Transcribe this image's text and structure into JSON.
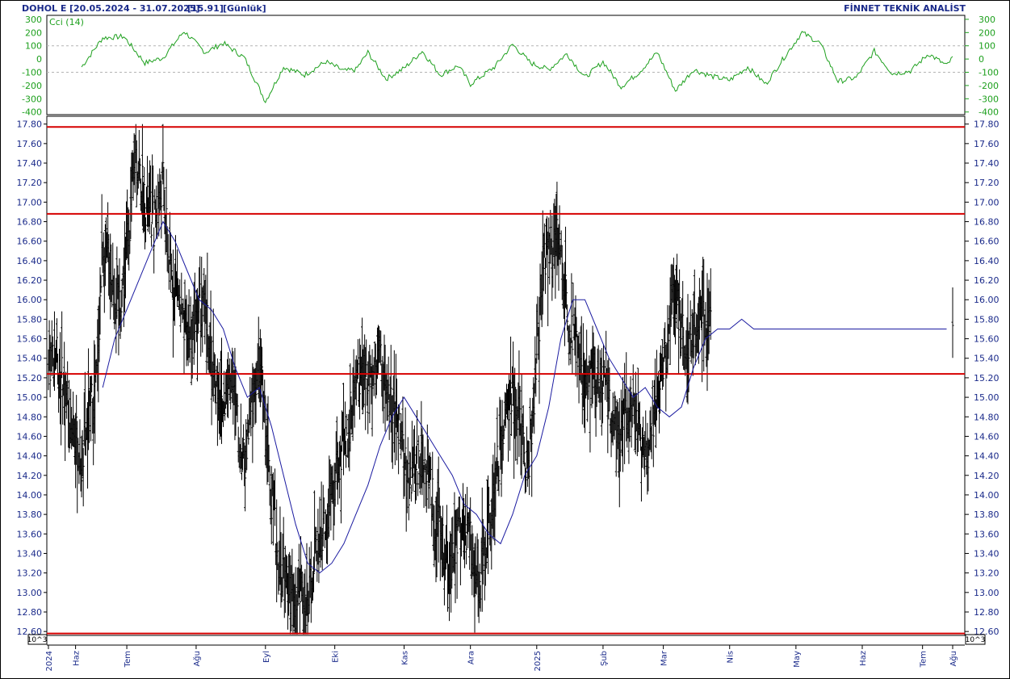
{
  "header": {
    "symbol": "DOHOL E",
    "date_range": "[20.05.2024 - 31.07.2025]",
    "last_price": "[15.91]",
    "period": "[Günlük]",
    "brand": "FİNNET TEKNİK ANALİST"
  },
  "colors": {
    "text": "#1a2a8a",
    "cci": "#1ea01e",
    "ma": "#1a1aa0",
    "bars": "#000000",
    "levels": "#d60000",
    "grid": "#b4b4b4",
    "frame": "#000000"
  },
  "chart_data": [
    {
      "type": "line",
      "label": "Cci (14)",
      "ylim": [
        -420,
        330
      ],
      "y_ticks": [
        300,
        200,
        100,
        0,
        -100,
        -200,
        -300,
        -400
      ],
      "y_tick_labels": [
        "300",
        "200",
        "100",
        "0",
        "-100",
        "-200",
        "-300",
        "-400"
      ],
      "dashed_levels": [
        100,
        -100
      ],
      "x_range": [
        0,
        300
      ],
      "x": [
        11,
        18,
        25,
        32,
        38,
        45,
        52,
        58,
        65,
        72,
        78,
        85,
        92,
        98,
        102,
        106,
        112,
        118,
        124,
        130,
        136,
        140,
        148,
        154,
        160,
        166,
        172,
        178,
        184,
        190,
        196,
        202,
        208,
        214,
        220,
        226,
        232,
        238,
        244,
        250,
        256,
        262,
        268,
        274,
        280,
        286,
        292,
        298,
        300
      ],
      "values": [
        -60,
        160,
        170,
        -30,
        10,
        210,
        50,
        120,
        10,
        -320,
        -60,
        -120,
        -20,
        -90,
        -80,
        50,
        -150,
        -70,
        60,
        -120,
        -50,
        -190,
        -60,
        110,
        -30,
        -80,
        40,
        -140,
        -20,
        -210,
        -100,
        50,
        -240,
        -80,
        -130,
        -160,
        -60,
        -190,
        10,
        200,
        120,
        -170,
        -140,
        60,
        -110,
        -90,
        40,
        -50,
        10
      ],
      "description": "oscillator series estimated from the drawn line"
    },
    {
      "type": "ohlc",
      "ylabel_unit": "10^3",
      "ylim": [
        12.56,
        17.88
      ],
      "y_ticks": [
        17.8,
        17.6,
        17.4,
        17.2,
        17.0,
        16.8,
        16.6,
        16.4,
        16.2,
        16.0,
        15.8,
        15.6,
        15.4,
        15.2,
        15.0,
        14.8,
        14.6,
        14.4,
        14.2,
        14.0,
        13.8,
        13.6,
        13.4,
        13.2,
        13.0,
        12.8,
        12.6
      ],
      "y_tick_labels": [
        "17.80",
        "17.60",
        "17.40",
        "17.20",
        "17.00",
        "16.80",
        "16.60",
        "16.40",
        "16.20",
        "16.00",
        "15.80",
        "15.60",
        "15.40",
        "15.20",
        "15.00",
        "14.80",
        "14.60",
        "14.40",
        "14.20",
        "14.00",
        "13.80",
        "13.60",
        "13.40",
        "13.20",
        "13.00",
        "12.80",
        "12.60"
      ],
      "horizontal_levels": [
        17.77,
        16.88,
        15.24,
        12.58
      ],
      "x_range": [
        0,
        300
      ],
      "anchors_x": [
        0,
        2,
        5,
        9,
        11,
        13,
        16,
        18,
        20,
        23,
        25,
        27,
        29,
        32,
        35,
        38,
        40,
        43,
        45,
        48,
        50,
        53,
        55,
        58,
        61,
        63,
        65,
        68,
        70,
        72,
        74,
        76,
        78,
        80,
        82,
        84,
        86,
        88,
        90,
        92,
        94,
        96,
        99,
        101,
        103,
        106,
        108,
        110,
        112,
        115,
        117,
        119,
        122,
        124,
        126,
        128,
        130,
        133,
        135,
        137,
        140,
        142,
        145,
        147,
        150,
        152,
        155,
        157,
        159,
        162,
        164,
        166,
        169,
        171,
        173,
        176,
        178,
        180,
        183,
        185,
        187,
        190,
        192,
        194,
        197,
        199,
        201,
        204,
        206,
        208,
        211,
        213,
        216,
        218,
        220,
        223,
        225,
        227,
        229,
        232,
        234,
        236,
        239,
        241,
        243,
        246,
        248,
        250,
        253,
        255,
        257,
        260,
        262,
        264,
        266,
        269,
        271,
        273,
        276,
        278,
        280,
        283,
        285,
        287,
        290,
        292,
        294,
        297,
        300
      ],
      "anchors_close": [
        15.2,
        15.5,
        15.1,
        14.6,
        14.3,
        14.7,
        15.2,
        16.6,
        16.4,
        15.9,
        16.2,
        16.8,
        17.5,
        17.0,
        16.8,
        17.2,
        16.3,
        16.1,
        15.6,
        15.7,
        16.0,
        15.7,
        15.2,
        14.9,
        15.3,
        14.6,
        14.3,
        15.0,
        15.3,
        14.8,
        14.0,
        13.4,
        13.2,
        13.0,
        12.9,
        13.1,
        12.8,
        13.3,
        13.5,
        13.7,
        14.0,
        14.3,
        14.6,
        15.0,
        15.3,
        15.1,
        15.4,
        15.5,
        15.0,
        14.8,
        14.6,
        14.1,
        14.3,
        14.4,
        14.2,
        13.8,
        13.6,
        13.2,
        13.5,
        13.7,
        13.6,
        13.0,
        13.4,
        13.9,
        14.5,
        14.9,
        15.0,
        14.6,
        14.2,
        15.4,
        16.3,
        16.5,
        16.7,
        16.2,
        15.8,
        15.4,
        15.1,
        15.2,
        15.0,
        15.1,
        14.8,
        14.6,
        14.8,
        15.0,
        14.4,
        14.3,
        14.9,
        15.3,
        15.8,
        16.0,
        15.6,
        15.5,
        15.9,
        15.8,
        15.8
      ],
      "moving_average": {
        "x": [
          18,
          22,
          26,
          30,
          34,
          38,
          42,
          46,
          50,
          54,
          58,
          62,
          66,
          70,
          74,
          78,
          82,
          86,
          90,
          94,
          98,
          102,
          106,
          110,
          114,
          118,
          122,
          126,
          130,
          134,
          138,
          142,
          146,
          150,
          154,
          158,
          162,
          166,
          170,
          174,
          178,
          182,
          186,
          190,
          194,
          198,
          202,
          206,
          210,
          214,
          218,
          222,
          226,
          230,
          234,
          238,
          242,
          246,
          250,
          254,
          258,
          262,
          266,
          270,
          274,
          278,
          282,
          286,
          290,
          294,
          298
        ],
        "values": [
          15.1,
          15.6,
          15.9,
          16.2,
          16.5,
          16.8,
          16.6,
          16.3,
          16.0,
          15.9,
          15.7,
          15.3,
          15.0,
          15.1,
          14.7,
          14.2,
          13.7,
          13.3,
          13.2,
          13.3,
          13.5,
          13.8,
          14.1,
          14.5,
          14.8,
          15.0,
          14.8,
          14.6,
          14.4,
          14.2,
          13.9,
          13.8,
          13.6,
          13.5,
          13.8,
          14.2,
          14.4,
          14.9,
          15.6,
          16.0,
          16.0,
          15.7,
          15.4,
          15.2,
          15.0,
          15.1,
          14.9,
          14.8,
          14.9,
          15.3,
          15.6,
          15.7,
          15.7,
          15.8,
          15.7,
          15.7,
          15.7,
          15.7,
          15.7,
          15.7,
          15.7,
          15.7,
          15.7,
          15.7,
          15.7,
          15.7,
          15.7,
          15.7,
          15.7,
          15.7,
          15.7
        ],
        "trimmed_to_x": 299
      },
      "dates": [
        {
          "x": 0,
          "label": "2024"
        },
        {
          "x": 9,
          "label": "Haz"
        },
        {
          "x": 26,
          "label": "Tem"
        },
        {
          "x": 49,
          "label": "Ağu"
        },
        {
          "x": 72,
          "label": "Eyl"
        },
        {
          "x": 95,
          "label": "Eki"
        },
        {
          "x": 118,
          "label": "Kas"
        },
        {
          "x": 140,
          "label": "Ara"
        },
        {
          "x": 162,
          "label": "2025"
        },
        {
          "x": 184,
          "label": "Şub"
        },
        {
          "x": 204,
          "label": "Mar"
        },
        {
          "x": 226,
          "label": "Nis"
        },
        {
          "x": 248,
          "label": "May"
        },
        {
          "x": 270,
          "label": "Haz"
        },
        {
          "x": 290,
          "label": "Tem"
        },
        {
          "x": 300,
          "label": "Ağu"
        }
      ]
    }
  ]
}
